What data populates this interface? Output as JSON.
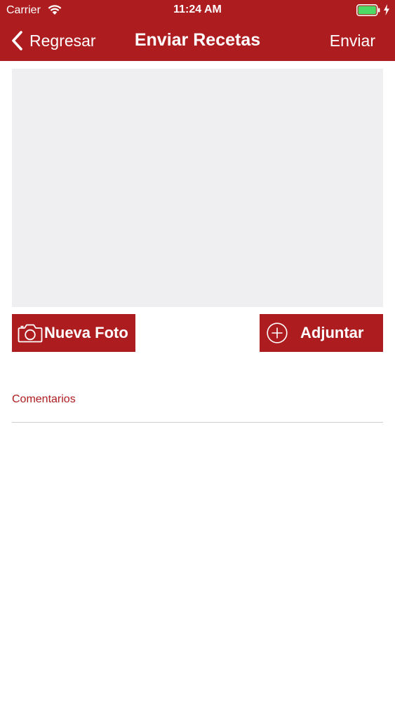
{
  "status_bar": {
    "carrier": "Carrier",
    "time": "11:24 AM",
    "wifi_icon": "wifi-icon",
    "battery_icon": "battery-charging-icon",
    "battery_color": "#4cd964"
  },
  "nav": {
    "back_label": "Regresar",
    "back_icon": "chevron-left-icon",
    "title": "Enviar Recetas",
    "send_label": "Enviar"
  },
  "actions": {
    "new_photo_label": "Nueva Foto",
    "new_photo_icon": "camera-icon",
    "attach_label": "Adjuntar",
    "attach_icon": "plus-circle-icon"
  },
  "comments": {
    "label": "Comentarios",
    "value": ""
  },
  "colors": {
    "brand_red": "#ad1c1f",
    "photo_placeholder": "#efeff1",
    "divider": "#cfcfd3"
  }
}
